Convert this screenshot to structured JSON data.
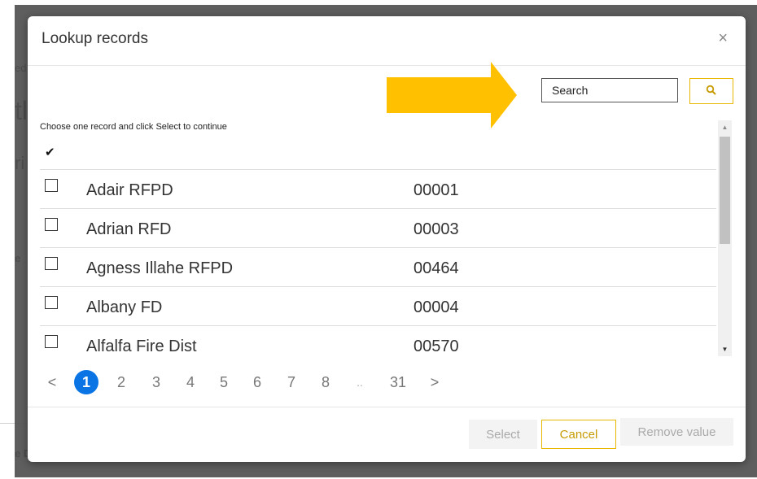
{
  "background": {
    "fragments": [
      "ed",
      "tl",
      "ri",
      "e",
      "e D"
    ]
  },
  "modal": {
    "title": "Lookup records",
    "close_label": "×",
    "search": {
      "placeholder": "Search",
      "value": ""
    },
    "instructions": "Choose one record and click Select to continue",
    "select_all_mark": "✔",
    "records": [
      {
        "name": "Adair RFPD",
        "code": "00001"
      },
      {
        "name": "Adrian RFD",
        "code": "00003"
      },
      {
        "name": "Agness Illahe RFPD",
        "code": "00464"
      },
      {
        "name": "Albany FD",
        "code": "00004"
      },
      {
        "name": "Alfalfa Fire Dist",
        "code": "00570"
      }
    ],
    "pagination": {
      "prev": "<",
      "pages": [
        "1",
        "2",
        "3",
        "4",
        "5",
        "6",
        "7",
        "8"
      ],
      "ellipsis": "..",
      "last": "31",
      "next": ">",
      "current": "1"
    },
    "buttons": {
      "select": "Select",
      "cancel": "Cancel",
      "remove": "Remove value"
    }
  },
  "colors": {
    "accent": "#e8b800",
    "arrow": "#ffc000",
    "active_page": "#0b74e5"
  }
}
